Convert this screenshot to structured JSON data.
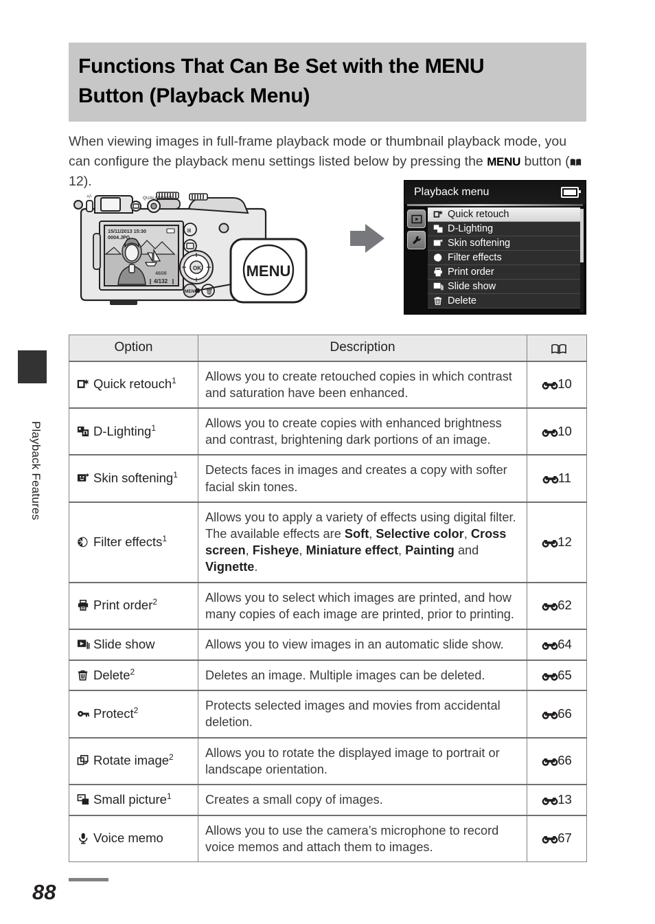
{
  "page": {
    "number": "88",
    "chapter_label": "Playback Features"
  },
  "title": {
    "line1_before": "Functions That Can Be Set with the ",
    "line1_menu": "MENU",
    "line2": "Button (Playback Menu)"
  },
  "intro": {
    "part1": "When viewing images in full-frame playback mode or thumbnail playback mode, you can configure the playback menu settings listed below by pressing the ",
    "menu_word": "MENU",
    "part2": " button (",
    "page_ref": "12",
    "part3": ")."
  },
  "camera_lcd": {
    "datetime": "15/11/2013 15:30",
    "filename": "0004.JPG",
    "quality": "4608",
    "frame_counter": "4/132"
  },
  "menu_callout": {
    "label": "MENU"
  },
  "playback_menu": {
    "header_title": "Playback menu",
    "battery_icon": "battery-icon",
    "tabs": [
      {
        "icon": "playback-tab-icon"
      },
      {
        "icon": "setup-wrench-tab-icon"
      }
    ],
    "items": [
      {
        "label": "Quick retouch",
        "icon": "quick-retouch-icon",
        "selected": true
      },
      {
        "label": "D-Lighting",
        "icon": "d-lighting-icon",
        "selected": false
      },
      {
        "label": "Skin softening",
        "icon": "skin-softening-icon",
        "selected": false
      },
      {
        "label": "Filter effects",
        "icon": "filter-effects-icon",
        "selected": false
      },
      {
        "label": "Print order",
        "icon": "print-order-icon",
        "selected": false
      },
      {
        "label": "Slide show",
        "icon": "slide-show-icon",
        "selected": false
      },
      {
        "label": "Delete",
        "icon": "delete-trash-icon",
        "selected": false
      }
    ]
  },
  "table": {
    "headers": {
      "option": "Option",
      "description": "Description",
      "reference": "book-icon"
    },
    "rows": [
      {
        "icon": "quick-retouch-icon",
        "option": "Quick retouch",
        "footnote": "1",
        "description": "Allows you to create retouched copies in which contrast and saturation have been enhanced.",
        "ref": "10"
      },
      {
        "icon": "d-lighting-icon",
        "option": "D-Lighting",
        "footnote": "1",
        "description": "Allows you to create copies with enhanced brightness and contrast, brightening dark portions of an image.",
        "ref": "10"
      },
      {
        "icon": "skin-softening-icon",
        "option": "Skin softening",
        "footnote": "1",
        "description": "Detects faces in images and creates a copy with softer facial skin tones.",
        "ref": "11"
      },
      {
        "icon": "filter-effects-icon",
        "option": "Filter effects",
        "footnote": "1",
        "description_html": "Allows you to apply a variety of effects using digital filter. The available effects are <b>Soft</b>, <b>Selective color</b>, <b>Cross screen</b>, <b>Fisheye</b>, <b>Miniature effect</b>, <b>Painting</b> and <b>Vignette</b>.",
        "ref": "12"
      },
      {
        "icon": "print-order-icon",
        "option": "Print order",
        "footnote": "2",
        "description": "Allows you to select which images are printed, and how many copies of each image are printed, prior to printing.",
        "ref": "62"
      },
      {
        "icon": "slide-show-icon",
        "option": "Slide show",
        "footnote": "",
        "description": "Allows you to view images in an automatic slide show.",
        "ref": "64"
      },
      {
        "icon": "delete-trash-icon",
        "option": "Delete",
        "footnote": "2",
        "description": "Deletes an image. Multiple images can be deleted.",
        "ref": "65"
      },
      {
        "icon": "protect-key-icon",
        "option": "Protect",
        "footnote": "2",
        "description": "Protects selected images and movies from accidental deletion.",
        "ref": "66"
      },
      {
        "icon": "rotate-image-icon",
        "option": "Rotate image",
        "footnote": "2",
        "description": "Allows you to rotate the displayed image to portrait or landscape orientation.",
        "ref": "66"
      },
      {
        "icon": "small-picture-icon",
        "option": "Small picture",
        "footnote": "1",
        "description": "Creates a small copy of images.",
        "ref": "13"
      },
      {
        "icon": "voice-memo-icon",
        "option": "Voice memo",
        "footnote": "",
        "description": "Allows you to use the camera’s microphone to record voice memos and attach them to images.",
        "ref": "67"
      }
    ]
  },
  "colors": {
    "title_band": "#c7c7c7",
    "table_header_bg": "#e9e9e9",
    "rule": "#808285",
    "arrow": "#77787b",
    "side_tab": "#333333"
  }
}
